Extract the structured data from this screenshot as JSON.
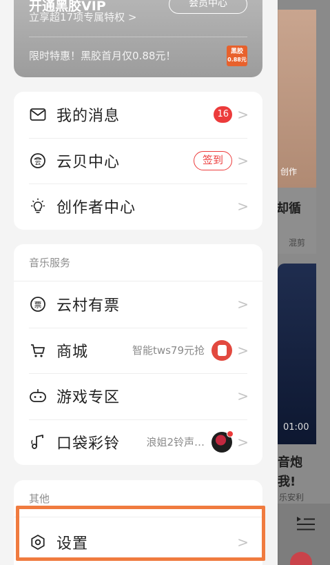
{
  "background_app": {
    "card1_label": "创作",
    "card1_title": "却循",
    "card1_tag": "混剪",
    "card2_time": "01:00",
    "card2_title_line1": "音炮",
    "card2_title_line2": "我!",
    "card2_artist": "乐安利"
  },
  "vip": {
    "title": "开通黑胶VIP",
    "button": "会员中心",
    "subtitle": "立享超17项专属特权 >",
    "promo": "限时特惠！黑胶首月仅0.88元！",
    "badge_line1": "黑胶",
    "badge_line2": "0.88元"
  },
  "main_menu": {
    "items": [
      {
        "label": "我的消息",
        "icon": "mail-icon",
        "badge": "16"
      },
      {
        "label": "云贝中心",
        "icon": "cloud-coin-icon",
        "pill": "签到"
      },
      {
        "label": "创作者中心",
        "icon": "lightbulb-icon"
      }
    ]
  },
  "music_services": {
    "title": "音乐服务",
    "items": [
      {
        "label": "云村有票",
        "icon": "ticket-icon"
      },
      {
        "label": "商城",
        "icon": "cart-icon",
        "hint": "智能tws79元抢"
      },
      {
        "label": "游戏专区",
        "icon": "gamepad-icon"
      },
      {
        "label": "口袋彩铃",
        "icon": "music-note-icon",
        "hint": "浪姐2铃声…"
      }
    ]
  },
  "other": {
    "title": "其他",
    "items": [
      {
        "label": "设置",
        "icon": "settings-icon"
      }
    ]
  },
  "chevron": ">",
  "colors": {
    "accent_red": "#ec3b3b",
    "highlight_orange": "#f07b3f"
  }
}
